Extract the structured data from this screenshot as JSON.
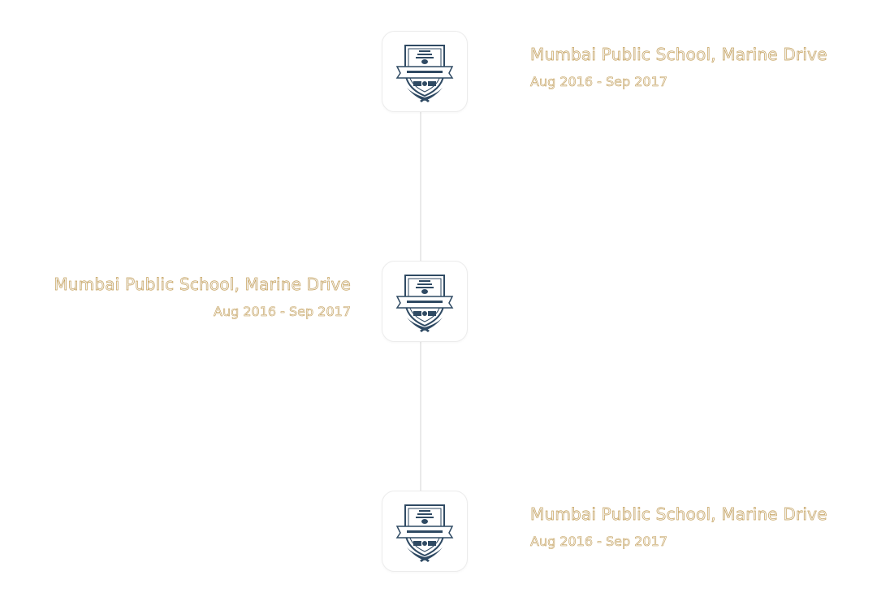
{
  "timeline": {
    "entries": [
      {
        "side": "right",
        "school_name": "Mumbai Public School, Marine Drive",
        "dates": "Aug 2016 - Sep 2017",
        "logo_icon": "school-crest-icon"
      },
      {
        "side": "left",
        "school_name": "Mumbai Public School, Marine Drive",
        "dates": "Aug 2016 - Sep 2017",
        "logo_icon": "school-crest-icon"
      },
      {
        "side": "right",
        "school_name": "Mumbai Public School, Marine Drive",
        "dates": "Aug 2016 - Sep 2017",
        "logo_icon": "school-crest-icon"
      }
    ]
  },
  "colors": {
    "crest": "#2f4a63",
    "text_outline": "#c6a15b",
    "line": "#e9e9e9"
  }
}
